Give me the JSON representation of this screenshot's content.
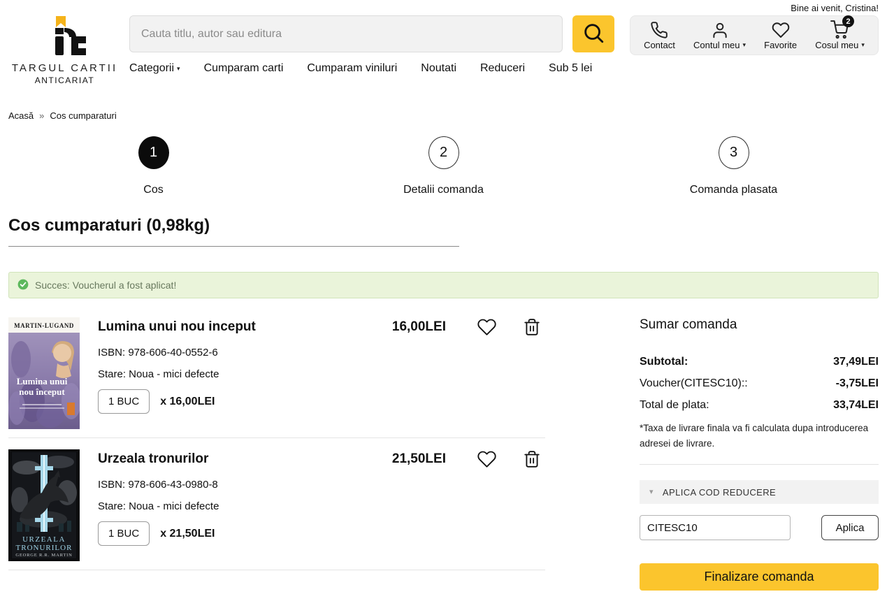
{
  "header": {
    "welcome": "Bine ai venit, Cristina!",
    "logo": {
      "title": "TARGUL CARTII",
      "subtitle": "ANTICARIAT"
    },
    "search": {
      "placeholder": "Cauta titlu, autor sau editura"
    },
    "actions": {
      "contact": "Contact",
      "account": "Contul meu",
      "favorites": "Favorite",
      "cart": "Cosul meu",
      "cart_badge": "2"
    },
    "nav": [
      "Categorii",
      "Cumparam carti",
      "Cumparam viniluri",
      "Noutati",
      "Reduceri",
      "Sub 5 lei"
    ]
  },
  "breadcrumb": {
    "home": "Acasă",
    "separator": "»",
    "current": "Cos cumparaturi"
  },
  "steps": [
    {
      "number": "1",
      "label": "Cos"
    },
    {
      "number": "2",
      "label": "Detalii comanda"
    },
    {
      "number": "3",
      "label": "Comanda plasata"
    }
  ],
  "page": {
    "title": "Cos cumparaturi (0,98kg)"
  },
  "alert": {
    "text": "Succes: Voucherul a fost aplicat!"
  },
  "cart": {
    "items": [
      {
        "title": "Lumina unui nou inceput",
        "price": "16,00LEI",
        "isbn": "ISBN: 978-606-40-0552-6",
        "condition": "Stare: Noua - mici defecte",
        "qty": "1 BUC",
        "unit_price": "x 16,00LEI",
        "cover": {
          "top": "MARTIN-LUGAND",
          "line1": "Lumina unui",
          "line2": "nou început"
        }
      },
      {
        "title": "Urzeala tronurilor",
        "price": "21,50LEI",
        "isbn": "ISBN: 978-606-43-0980-8",
        "condition": "Stare: Noua - mici defecte",
        "qty": "1 BUC",
        "unit_price": "x 21,50LEI",
        "cover": {
          "line1": "URZEALA",
          "line2": "TRONURILOR",
          "author": "GEORGE R.R. MARTIN"
        }
      }
    ]
  },
  "summary": {
    "title": "Sumar comanda",
    "rows": [
      {
        "label": "Subtotal:",
        "value": "37,49LEI"
      },
      {
        "label": "Voucher(CITESC10)::",
        "value": "-3,75LEI"
      },
      {
        "label": "Total de plata:",
        "value": "33,74LEI"
      }
    ],
    "note": "*Taxa de livrare finala va fi calculata dupa introducerea adresei de livrare.",
    "voucher": {
      "header": "APLICA COD REDUCERE",
      "code": "CITESC10",
      "apply_label": "Aplica"
    },
    "checkout_label": "Finalizare comanda"
  },
  "colors": {
    "accent": "#fbc52d",
    "badge": "#111111",
    "alert_bg": "#eaf4da",
    "alert_border": "#d0e4ba",
    "success_icon": "#5cb85c"
  }
}
